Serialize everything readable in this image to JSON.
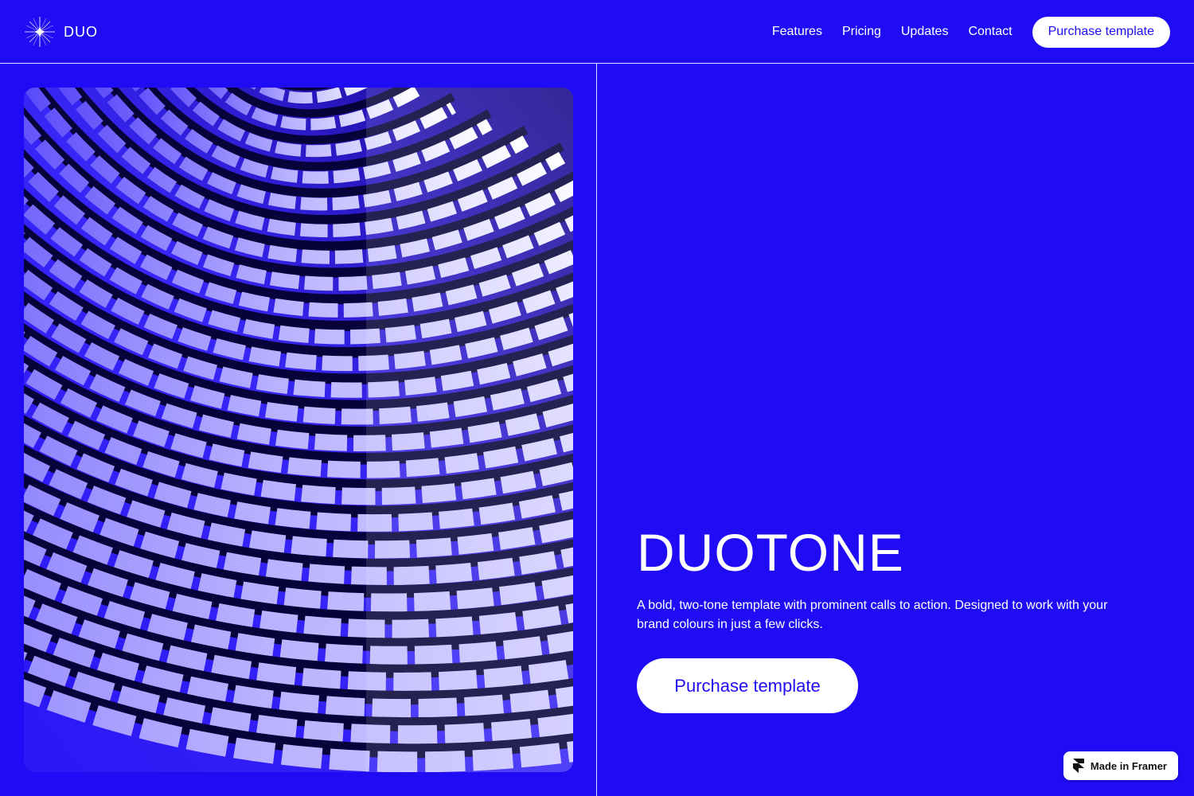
{
  "brand": {
    "name": "DUO",
    "icon": "sparkle-star-icon"
  },
  "nav": {
    "links": [
      "Features",
      "Pricing",
      "Updates",
      "Contact"
    ],
    "cta_label": "Purchase template"
  },
  "hero": {
    "image": "abstract-architectural-facade-photo",
    "title": "DUOTONE",
    "description": "A bold, two-tone template with prominent calls to action. Designed to work with your brand colours in just a few clicks.",
    "cta_label": "Purchase template"
  },
  "badge": {
    "label": "Made in Framer",
    "icon": "framer-logo-icon"
  },
  "colors": {
    "primary": "#1f0cf5",
    "surface": "#ffffff"
  }
}
